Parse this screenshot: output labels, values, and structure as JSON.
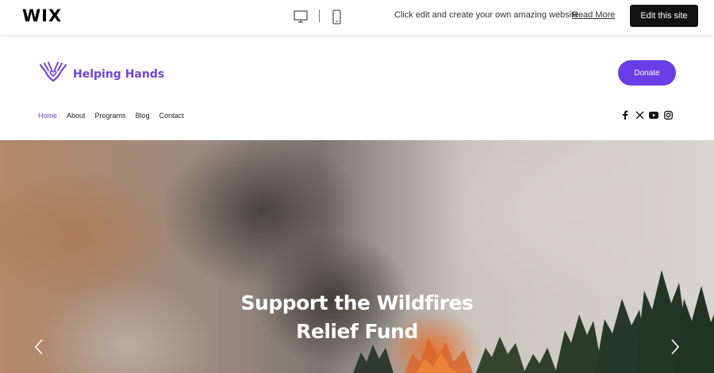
{
  "wix_bar": {
    "logo": "WIX",
    "message": "Click edit and create your own amazing website",
    "read_more": "Read More",
    "edit_button": "Edit this site"
  },
  "site": {
    "brand_name": "Helping Hands",
    "donate_button": "Donate",
    "nav": [
      {
        "label": "Home",
        "active": true
      },
      {
        "label": "About",
        "active": false
      },
      {
        "label": "Programs",
        "active": false
      },
      {
        "label": "Blog",
        "active": false
      },
      {
        "label": "Contact",
        "active": false
      }
    ],
    "social_icons": [
      "facebook-icon",
      "x-icon",
      "youtube-icon",
      "instagram-icon"
    ],
    "accent_color": "#6b45e0"
  },
  "hero": {
    "title_line1": "Support the Wildfires",
    "title_line2": "Relief Fund"
  }
}
